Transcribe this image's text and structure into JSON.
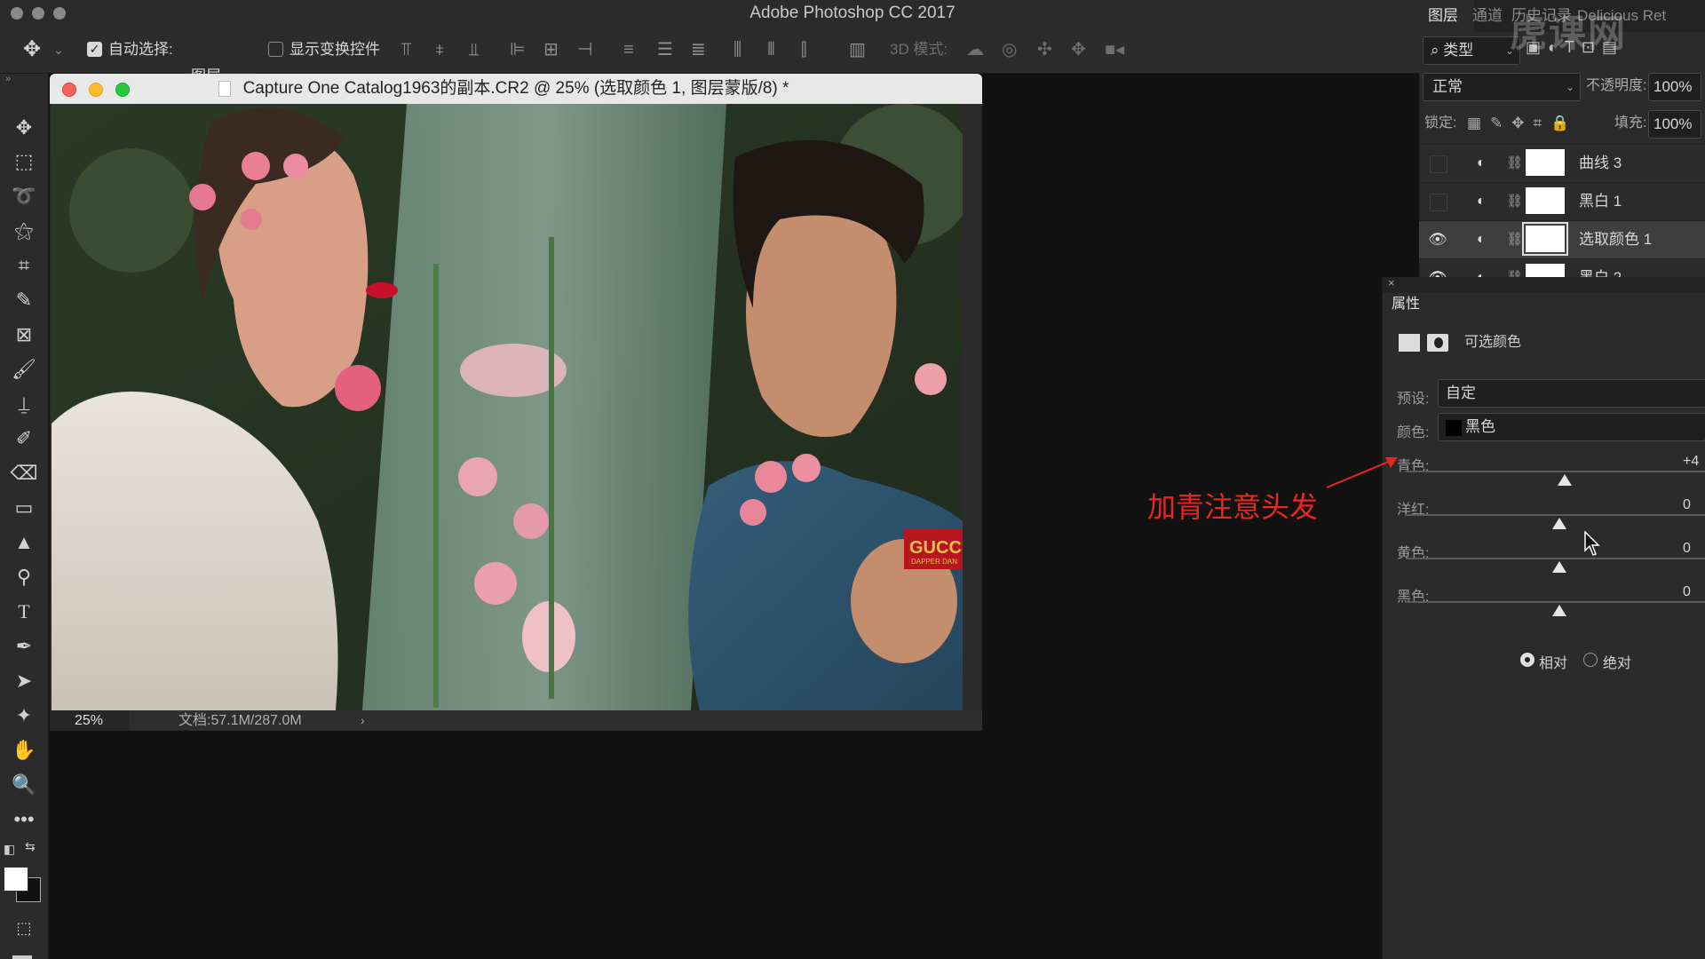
{
  "app": {
    "title": "Adobe Photoshop CC 2017"
  },
  "options_bar": {
    "auto_select_label": "自动选择:",
    "auto_select_value": "图层",
    "show_transform_label": "显示变换控件",
    "mode_3d_label": "3D 模式:"
  },
  "document": {
    "title": "Capture One Catalog1963的副本.CR2 @ 25% (选取颜色 1, 图层蒙版/8) *",
    "zoom": "25%",
    "doc_info": "文档:57.1M/287.0M",
    "canvas_text": "GUCC",
    "canvas_subtext": "DAPPER DAN"
  },
  "layers_panel": {
    "tabs": [
      "图层",
      "通道",
      "历史记录",
      "Delicious Ret"
    ],
    "filter_label": "类型",
    "blend_mode": "正常",
    "opacity_label": "不透明度:",
    "opacity_value": "100%",
    "lock_label": "锁定:",
    "fill_label": "填充:",
    "fill_value": "100%",
    "layers": [
      {
        "name": "曲线 3",
        "visible": false
      },
      {
        "name": "黑白 1",
        "visible": false
      },
      {
        "name": "选取颜色 1",
        "visible": true,
        "selected": true
      },
      {
        "name": "黑白 2",
        "visible": true
      }
    ]
  },
  "properties_panel": {
    "title": "属性",
    "adjustment_name": "可选颜色",
    "preset_label": "预设:",
    "preset_value": "自定",
    "color_label": "颜色:",
    "color_value": "黑色",
    "sliders": [
      {
        "label": "青色:",
        "value": "+4",
        "fraction": 0.52
      },
      {
        "label": "洋红:",
        "value": "0",
        "fraction": 0.5
      },
      {
        "label": "黄色:",
        "value": "0",
        "fraction": 0.5
      },
      {
        "label": "黑色:",
        "value": "0",
        "fraction": 0.5
      }
    ],
    "mode_relative": "相对",
    "mode_absolute": "绝对",
    "selected_mode": "relative"
  },
  "annotation": {
    "text": "加青注意头发",
    "color": "#e8271d"
  },
  "watermark": {
    "text": "虎课网"
  },
  "colors": {
    "accent_red": "#e8271d",
    "panel_bg": "#2b2b2b",
    "workspace_bg": "#111111"
  }
}
